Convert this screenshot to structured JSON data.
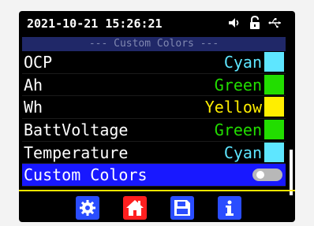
{
  "status": {
    "datetime": "2021-10-21 15:26:21",
    "icons": [
      "speaker-icon",
      "unlocked-icon",
      "usb-icon"
    ]
  },
  "menu": {
    "header": "--- Custom Colors ---",
    "rows": [
      {
        "label": "OCP",
        "value": "Cyan",
        "color": "#5ee6ff"
      },
      {
        "label": "Ah",
        "value": "Green",
        "color": "#22dd00"
      },
      {
        "label": "Wh",
        "value": "Yellow",
        "color": "#ffee00"
      },
      {
        "label": "BattVoltage",
        "value": "Green",
        "color": "#22dd00"
      },
      {
        "label": "Temperature",
        "value": "Cyan",
        "color": "#5ee6ff"
      }
    ],
    "selected_row": {
      "label": "Custom Colors",
      "toggle_on": false
    }
  },
  "toolbar": {
    "buttons": [
      "settings-icon",
      "home-icon",
      "save-icon",
      "info-icon"
    ]
  },
  "colors": {
    "accent_blue": "#2a4dff",
    "accent_red": "#ff1f1f",
    "separator_yellow": "#ffe600",
    "header_bg": "#202868"
  }
}
